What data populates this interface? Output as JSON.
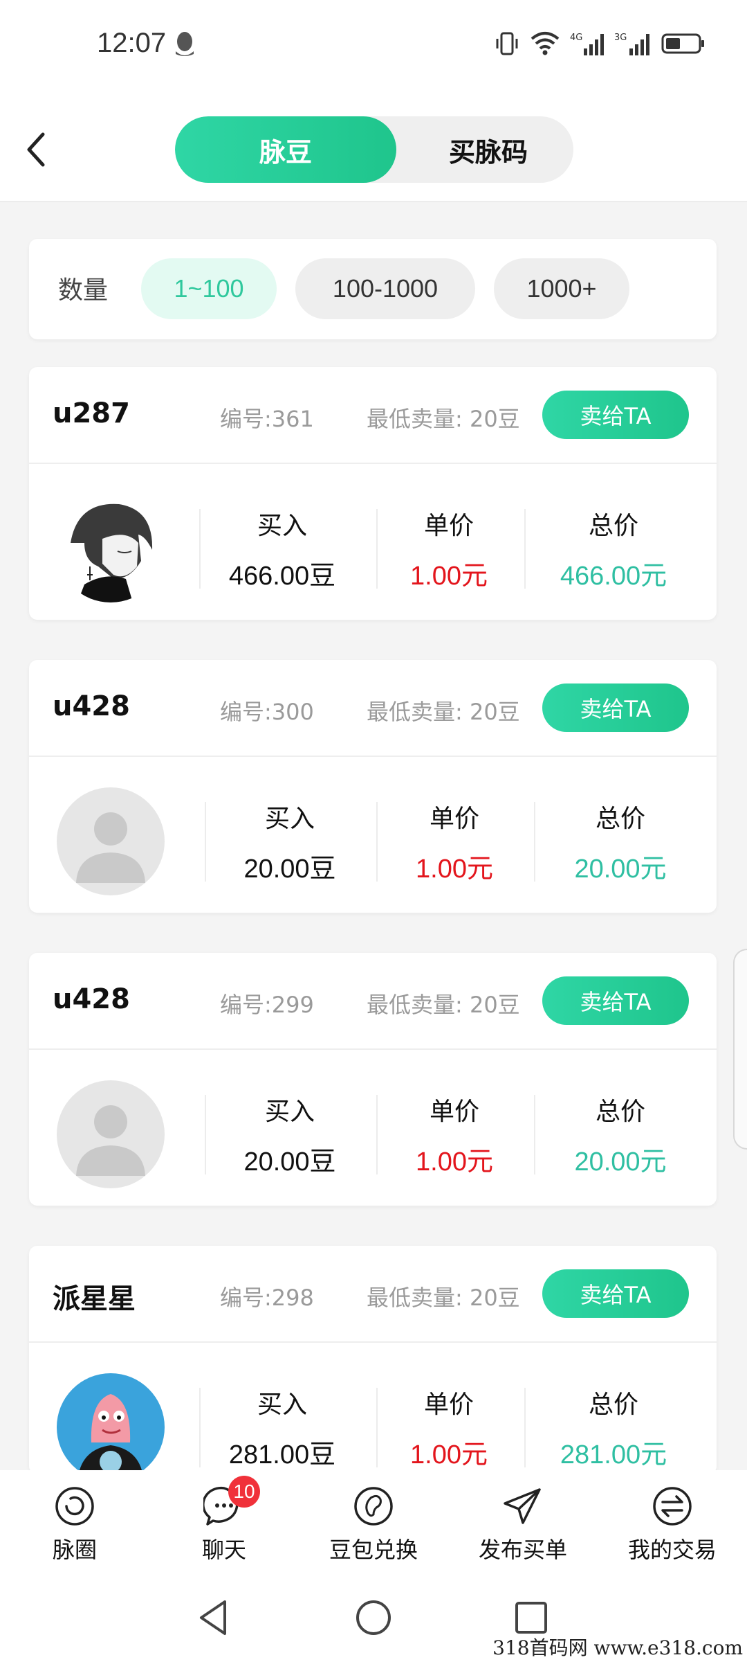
{
  "status_bar": {
    "time": "12:07"
  },
  "header": {
    "tabs": [
      {
        "label": "脉豆",
        "active": true
      },
      {
        "label": "买脉码",
        "active": false
      }
    ]
  },
  "filter": {
    "label": "数量",
    "options": [
      "1~100",
      "100-1000",
      "1000+"
    ],
    "selected": "1~100"
  },
  "listings": [
    {
      "name": "u287",
      "order_no": "编号:361",
      "min_sell": "最低卖量:  20豆",
      "sell_button": "卖给TA",
      "avatar": "anime-boy-avatar",
      "buy_label": "买入",
      "buy_value": "466.00豆",
      "price_label": "单价",
      "price_value": "1.00元",
      "total_label": "总价",
      "total_value": "466.00元"
    },
    {
      "name": "u428",
      "order_no": "编号:300",
      "min_sell": "最低卖量:  20豆",
      "sell_button": "卖给TA",
      "avatar": "default-avatar",
      "buy_label": "买入",
      "buy_value": "20.00豆",
      "price_label": "单价",
      "price_value": "1.00元",
      "total_label": "总价",
      "total_value": "20.00元"
    },
    {
      "name": "u428",
      "order_no": "编号:299",
      "min_sell": "最低卖量:  20豆",
      "sell_button": "卖给TA",
      "avatar": "default-avatar",
      "buy_label": "买入",
      "buy_value": "20.00豆",
      "price_label": "单价",
      "price_value": "1.00元",
      "total_label": "总价",
      "total_value": "20.00元"
    },
    {
      "name": "派星星",
      "order_no": "编号:298",
      "min_sell": "最低卖量:  20豆",
      "sell_button": "卖给TA",
      "avatar": "cartoon-starfish-avatar",
      "buy_label": "买入",
      "buy_value": "281.00豆",
      "price_label": "单价",
      "price_value": "1.00元",
      "total_label": "总价",
      "total_value": "281.00元"
    }
  ],
  "bottom_nav": [
    {
      "label": "脉圈",
      "icon": "circle-refresh-icon"
    },
    {
      "label": "聊天",
      "icon": "chat-bubble-icon",
      "badge": "10"
    },
    {
      "label": "豆包兑换",
      "icon": "bean-icon"
    },
    {
      "label": "发布买单",
      "icon": "paper-plane-icon"
    },
    {
      "label": "我的交易",
      "icon": "exchange-arrows-icon"
    }
  ],
  "watermark": "318首码网  www.e318.com",
  "colors": {
    "accent": "#2fd6a5",
    "price_red": "#e3151c",
    "total_teal": "#2fbfa2",
    "badge_red": "#f0313a"
  }
}
